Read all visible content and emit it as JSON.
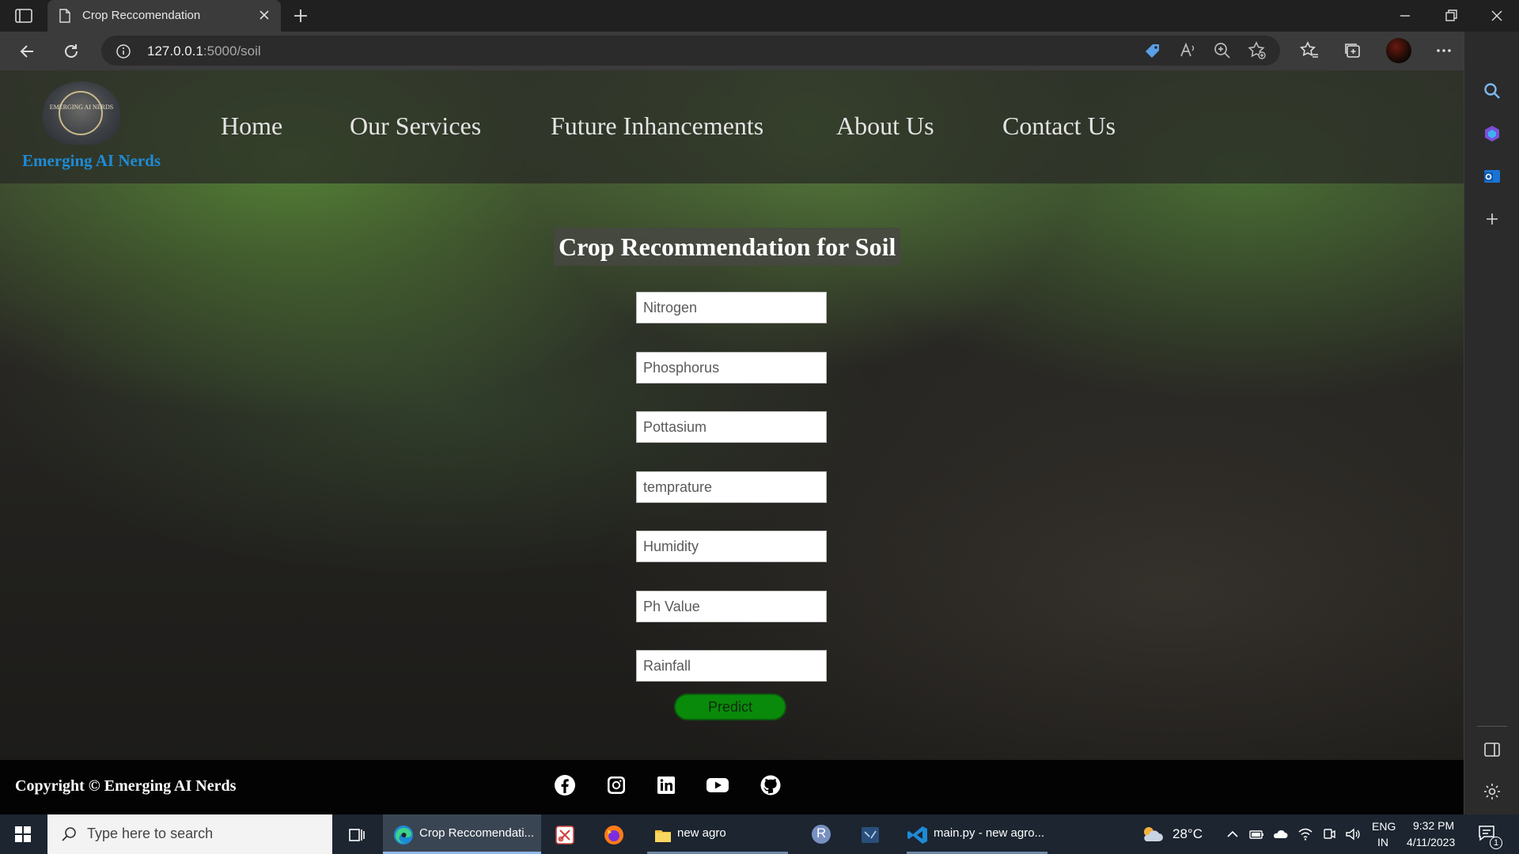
{
  "browser": {
    "tab_title": "Crop Reccomendation",
    "url_host": "127.0.0.1",
    "url_path": ":5000/soil"
  },
  "site": {
    "logo_text": "EMERGING AI NERDS",
    "brand": "Emerging AI Nerds",
    "nav": [
      "Home",
      "Our Services",
      "Future Inhancements",
      "About Us",
      "Contact Us"
    ]
  },
  "form": {
    "title": "Crop Recommendation for Soil",
    "fields": [
      {
        "placeholder": "Nitrogen",
        "value": ""
      },
      {
        "placeholder": "Phosphorus",
        "value": ""
      },
      {
        "placeholder": "Pottasium",
        "value": ""
      },
      {
        "placeholder": "temprature",
        "value": ""
      },
      {
        "placeholder": "Humidity",
        "value": ""
      },
      {
        "placeholder": "Ph Value",
        "value": ""
      },
      {
        "placeholder": "Rainfall",
        "value": ""
      }
    ],
    "submit_label": "Predict",
    "submit_color": "#0a8a0a"
  },
  "footer": {
    "copyright": "Copyright © Emerging AI Nerds",
    "social_icons": [
      "facebook-icon",
      "instagram-icon",
      "linkedin-icon",
      "youtube-icon",
      "github-icon"
    ]
  },
  "taskbar": {
    "search_placeholder": "Type here to search",
    "apps": [
      {
        "name": "edge",
        "label": "Crop Reccomendati..."
      },
      {
        "name": "file-explorer",
        "label": "new agro"
      },
      {
        "name": "vscode",
        "label": "main.py - new agro..."
      }
    ],
    "temperature": "28°C",
    "language": "ENG",
    "region": "IN",
    "time": "9:32 PM",
    "date": "4/11/2023",
    "notification_count": "1",
    "r_app_letter": "R"
  }
}
